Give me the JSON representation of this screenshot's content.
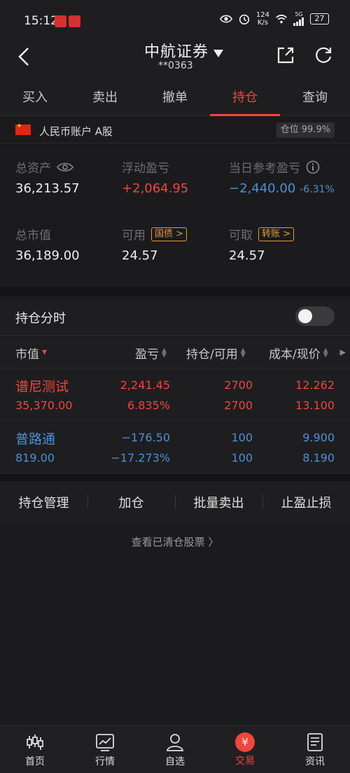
{
  "status_bar": {
    "time": "15:12",
    "net_speed_value": "124",
    "net_speed_unit": "K/s",
    "signal_label": "5G",
    "battery": "27"
  },
  "header": {
    "title": "中航证券",
    "account": "**0363"
  },
  "tabs": [
    {
      "label": "买入",
      "active": false
    },
    {
      "label": "卖出",
      "active": false
    },
    {
      "label": "撤单",
      "active": false
    },
    {
      "label": "持仓",
      "active": true
    },
    {
      "label": "查询",
      "active": false
    }
  ],
  "account_line": {
    "label": "人民币账户 A股",
    "position_ratio": "仓位 99.9%"
  },
  "summary": {
    "total_assets_label": "总资产",
    "total_assets": "36,213.57",
    "floating_pnl_label": "浮动盈亏",
    "floating_pnl": "+2,064.95",
    "today_pnl_label": "当日参考盈亏",
    "today_pnl": "−2,440.00",
    "today_pnl_pct": "-6.31%",
    "market_value_label": "总市值",
    "market_value": "36,189.00",
    "available_label": "可用",
    "available_tag": "国债 >",
    "available": "24.57",
    "withdrawable_label": "可取",
    "withdrawable_tag": "转账 >",
    "withdrawable": "24.57"
  },
  "holding_timing": {
    "label": "持仓分时",
    "enabled": false
  },
  "table": {
    "headers": {
      "market_value": "市值",
      "pnl": "盈亏",
      "position": "持仓/可用",
      "cost": "成本/现价"
    },
    "rows": [
      {
        "name": "谱尼测试",
        "market_value": "35,370.00",
        "pnl": "2,241.45",
        "pnl_pct": "6.835%",
        "position": "2700",
        "available": "2700",
        "cost": "12.262",
        "price": "13.100",
        "color": "#f0463c"
      },
      {
        "name": "普路通",
        "market_value": "819.00",
        "pnl": "−176.50",
        "pnl_pct": "−17.273%",
        "position": "100",
        "available": "100",
        "cost": "9.900",
        "price": "8.190",
        "color": "#4d8fd8"
      }
    ]
  },
  "actions": [
    "持仓管理",
    "加仓",
    "批量卖出",
    "止盈止损"
  ],
  "cleared_link": "查看已清仓股票 〉",
  "bottom_nav": [
    {
      "label": "首页",
      "icon": "candlestick-icon",
      "active": false
    },
    {
      "label": "行情",
      "icon": "chart-icon",
      "active": false
    },
    {
      "label": "自选",
      "icon": "user-icon",
      "active": false
    },
    {
      "label": "交易",
      "icon": "yuan-icon",
      "active": true
    },
    {
      "label": "资讯",
      "icon": "news-icon",
      "active": false
    }
  ],
  "colors": {
    "up": "#f0463c",
    "down": "#4d8fd8",
    "accent_tag": "#e59a2e"
  }
}
